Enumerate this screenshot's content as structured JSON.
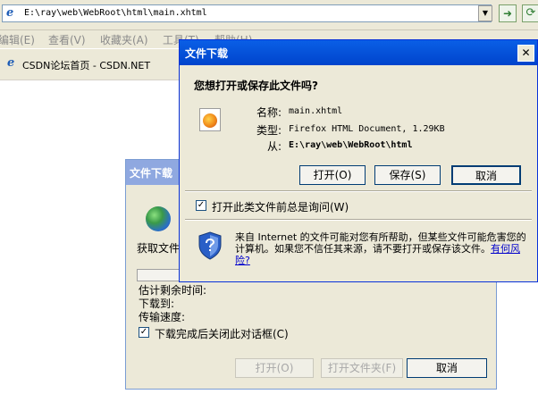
{
  "browser": {
    "address": "E:\\ray\\web\\WebRoot\\html\\main.xhtml",
    "menu": [
      "编辑(E)",
      "查看(V)",
      "收藏夹(A)",
      "工具(T)",
      "帮助(H)"
    ],
    "tab_title": "CSDN论坛首页 - CSDN.NET"
  },
  "download_dialog": {
    "title": "文件下载",
    "fetching": "获取文件",
    "eta_label": "估计剩余时间:",
    "dest_label": "下载到:",
    "rate_label": "传输速度:",
    "close_on_complete": "下载完成后关闭此对话框(C)",
    "close_on_complete_checked": true,
    "open_button": "打开(O)",
    "open_folder_button": "打开文件夹(F)",
    "cancel_button": "取消"
  },
  "file_dialog": {
    "title": "文件下载",
    "question": "您想打开或保存此文件吗?",
    "name_label": "名称:",
    "name_value": "main.xhtml",
    "type_label": "类型:",
    "type_value": "Firefox HTML Document, 1.29KB",
    "from_label": "从:",
    "from_value": "E:\\ray\\web\\WebRoot\\html",
    "open_button": "打开(O)",
    "save_button": "保存(S)",
    "cancel_button": "取消",
    "always_ask": "打开此类文件前总是询问(W)",
    "always_ask_checked": true,
    "warning_text": "来自 Internet 的文件可能对您有所帮助，但某些文件可能危害您的计算机。如果您不信任其来源，请不要打开或保存该文件。",
    "risk_link": "有何风险?"
  },
  "colors": {
    "title_active": "#0054e3",
    "title_inactive": "#8fa8e0",
    "dialog_bg": "#ece9d8",
    "link": "#0000cc"
  },
  "icons": {
    "browser": "ie-icon",
    "go": "go-icon",
    "refresh": "refresh-icon",
    "globe": "globe-icon",
    "file": "firefox-file-icon",
    "shield": "security-shield-icon",
    "close": "close-icon"
  }
}
